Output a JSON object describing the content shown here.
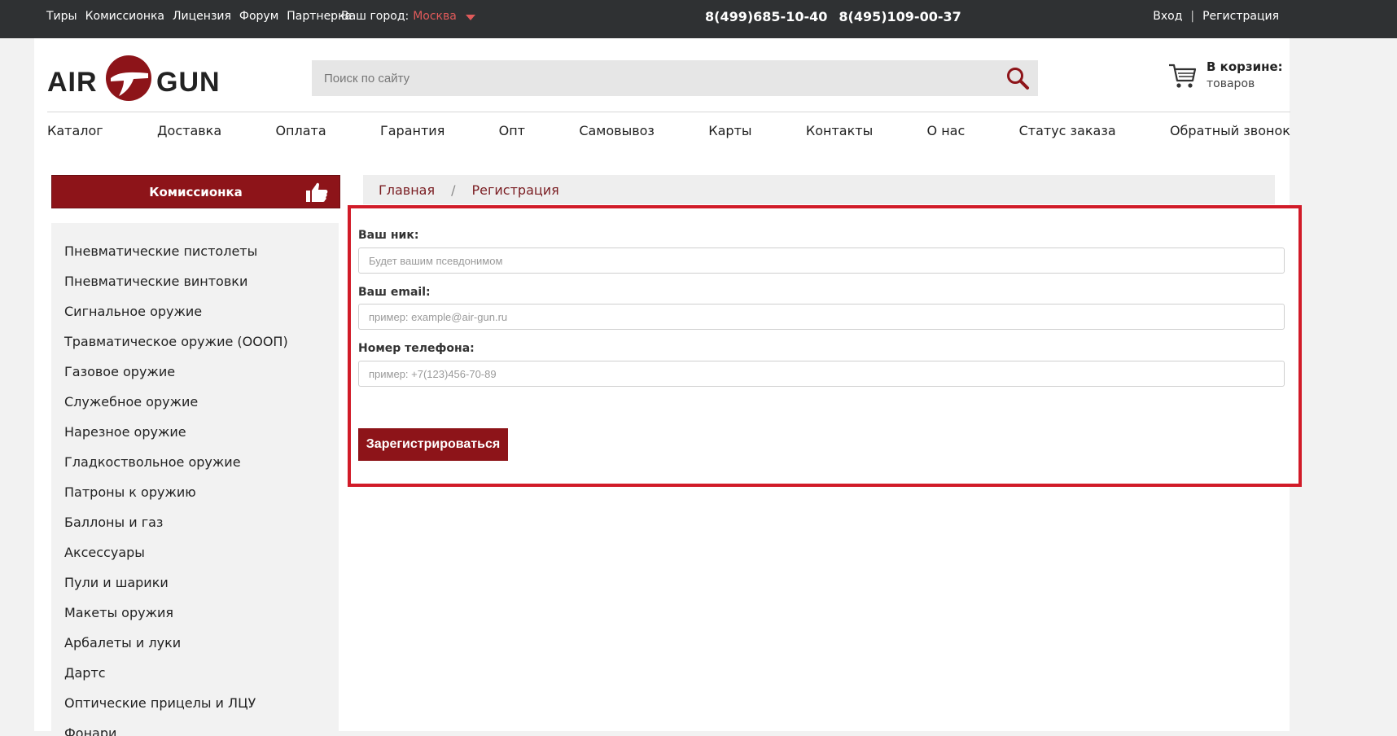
{
  "topbar": {
    "links": [
      "Тиры",
      "Комиссионка",
      "Лицензия",
      "Форум",
      "Партнерка"
    ],
    "city_label": "Ваш город:",
    "city_value": "Москва",
    "phones": [
      "8(499)685-10-40",
      "8(495)109-00-37"
    ],
    "login": "Вход",
    "separator": "|",
    "register": "Регистрация"
  },
  "header": {
    "logo_left": "AIR",
    "logo_right": "GUN",
    "search_placeholder": "Поиск по сайту",
    "cart_title": "В корзине:",
    "cart_sub": "товаров"
  },
  "nav": [
    "Каталог",
    "Доставка",
    "Оплата",
    "Гарантия",
    "Опт",
    "Самовывоз",
    "Карты",
    "Контакты",
    "О нас",
    "Статус заказа",
    "Обратный звонок"
  ],
  "sidebar": {
    "header": "Комиссионка",
    "items": [
      "Пневматические пистолеты",
      "Пневматические винтовки",
      "Сигнальное оружие",
      "Травматическое оружие (ОООП)",
      "Газовое оружие",
      "Служебное оружие",
      "Нарезное оружие",
      "Гладкоствольное оружие",
      "Патроны к оружию",
      "Баллоны и газ",
      "Аксессуары",
      "Пули и шарики",
      "Макеты оружия",
      "Арбалеты и луки",
      "Дартс",
      "Оптические прицелы и ЛЦУ",
      "Фонари"
    ]
  },
  "breadcrumb": {
    "home": "Главная",
    "separator": "/",
    "current": "Регистрация"
  },
  "form": {
    "nick_label": "Ваш ник:",
    "nick_placeholder": "Будет вашим псевдонимом",
    "email_label": "Ваш email:",
    "email_placeholder": "пример: example@air-gun.ru",
    "phone_label": "Номер телефона:",
    "phone_placeholder": "пример: +7(123)456-70-89",
    "submit": "Зарегистрироваться"
  },
  "colors": {
    "brand": "#8d1419",
    "highlight": "#d11b28",
    "topbar": "#2f3133",
    "city_accent": "#e05a5a"
  }
}
